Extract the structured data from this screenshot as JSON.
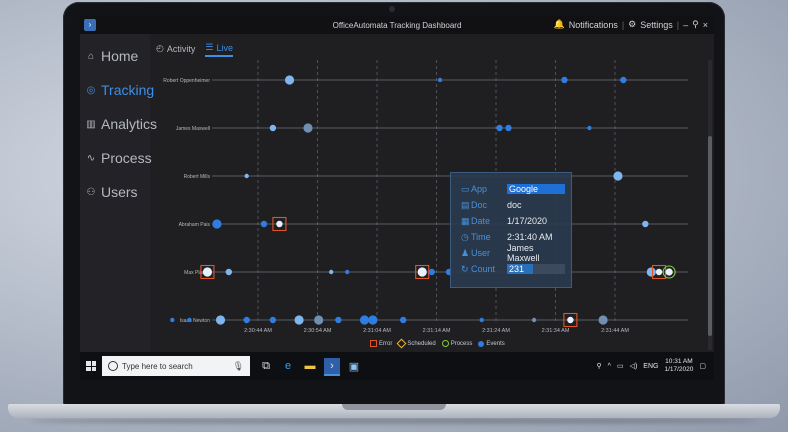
{
  "window": {
    "title": "OfficeAutomata Tracking Dashboard",
    "notifications_label": "Notifications",
    "settings_label": "Settings",
    "minimize_symbol": "–",
    "pin_symbol": "⚲",
    "close_symbol": "×",
    "logo_glyph": "›"
  },
  "sidebar": {
    "items": [
      {
        "label": "Home",
        "icon": "home-icon",
        "glyph": "⌂"
      },
      {
        "label": "Tracking",
        "icon": "radar-icon",
        "glyph": "◎",
        "active": true
      },
      {
        "label": "Analytics",
        "icon": "chart-icon",
        "glyph": "▥"
      },
      {
        "label": "Process",
        "icon": "process-icon",
        "glyph": "∿"
      },
      {
        "label": "Users",
        "icon": "users-icon",
        "glyph": "⚇"
      }
    ]
  },
  "tabs": [
    {
      "label": "Activity",
      "icon": "activity-icon",
      "glyph": "◴"
    },
    {
      "label": "Live",
      "icon": "live-icon",
      "glyph": "☰",
      "active": true
    }
  ],
  "tooltip": {
    "rows": [
      {
        "key": "App",
        "value": "Google",
        "icon": "window-icon",
        "glyph": "▭",
        "highlight": true
      },
      {
        "key": "Doc",
        "value": "doc",
        "icon": "document-icon",
        "glyph": "▤"
      },
      {
        "key": "Date",
        "value": "1/17/2020",
        "icon": "calendar-icon",
        "glyph": "▦"
      },
      {
        "key": "Time",
        "value": "2:31:40 AM",
        "icon": "clock-icon",
        "glyph": "◷"
      },
      {
        "key": "User",
        "value": "James Maxwell",
        "icon": "user-icon",
        "glyph": "♟"
      }
    ],
    "count": {
      "key": "Count",
      "value": "231",
      "icon": "count-icon",
      "glyph": "↻",
      "fill_fraction": 0.45
    }
  },
  "legend": [
    {
      "label": "Error",
      "shape": "square",
      "color": "#e2542a"
    },
    {
      "label": "Scheduled",
      "shape": "diamond",
      "color": "#f0b43c"
    },
    {
      "label": "Process",
      "shape": "circle",
      "color": "#7ccf3a"
    },
    {
      "label": "Events",
      "shape": "dot",
      "color": "#2f7de1"
    }
  ],
  "chart_data": {
    "type": "scatter",
    "categories": [
      "Robert Oppenheimer",
      "James Maxwell",
      "Robert Mills",
      "Abraham Pais",
      "Max Planck",
      "Isaac Newton"
    ],
    "x_ticks": [
      "2:30:44 AM",
      "2:30:54 AM",
      "2:31:04 AM",
      "2:31:14 AM",
      "2:31:24 AM",
      "2:31:34 AM",
      "2:31:44 AM"
    ],
    "x_unit": "seconds after 2:30:34 AM",
    "xlim": [
      0,
      80
    ],
    "grid": "vertical dashed",
    "legend_position": "bottom-center",
    "colors": {
      "event": "#2f7de1",
      "event_light": "#7fb6ee",
      "error": "#e2542a",
      "process": "#7ccf3a",
      "line": "#6e7077"
    },
    "points": [
      {
        "row": 0,
        "x": 15.3,
        "size": "large",
        "kind": "event_light"
      },
      {
        "row": 0,
        "x": 40.6,
        "size": "small",
        "kind": "event"
      },
      {
        "row": 0,
        "x": 61.5,
        "size": "medium",
        "kind": "event"
      },
      {
        "row": 0,
        "x": 71.4,
        "size": "medium",
        "kind": "event"
      },
      {
        "row": 1,
        "x": 12.5,
        "size": "medium",
        "kind": "event_light"
      },
      {
        "row": 1,
        "x": 18.4,
        "size": "large",
        "kind": "event_grey"
      },
      {
        "row": 1,
        "x": 50.6,
        "size": "medium",
        "kind": "event"
      },
      {
        "row": 1,
        "x": 52.1,
        "size": "medium",
        "kind": "event"
      },
      {
        "row": 1,
        "x": 65.7,
        "size": "small",
        "kind": "event"
      },
      {
        "row": 2,
        "x": 8.1,
        "size": "small",
        "kind": "event_light"
      },
      {
        "row": 2,
        "x": 70.5,
        "size": "large",
        "kind": "event_light"
      },
      {
        "row": 3,
        "x": 3.1,
        "size": "large",
        "kind": "event"
      },
      {
        "row": 3,
        "x": 11.0,
        "size": "medium",
        "kind": "event"
      },
      {
        "row": 3,
        "x": 13.6,
        "size": "medium",
        "kind": "error_box"
      },
      {
        "row": 3,
        "x": 75.1,
        "size": "medium",
        "kind": "event_light"
      },
      {
        "row": 4,
        "x": 1.5,
        "size": "large",
        "kind": "error_box"
      },
      {
        "row": 4,
        "x": 5.1,
        "size": "medium",
        "kind": "event_light"
      },
      {
        "row": 4,
        "x": 22.3,
        "size": "small",
        "kind": "event_light"
      },
      {
        "row": 4,
        "x": 25.0,
        "size": "small",
        "kind": "event"
      },
      {
        "row": 4,
        "x": 37.6,
        "size": "large",
        "kind": "error_box"
      },
      {
        "row": 4,
        "x": 39.2,
        "size": "medium",
        "kind": "event"
      },
      {
        "row": 4,
        "x": 42.1,
        "size": "medium",
        "kind": "event"
      },
      {
        "row": 4,
        "x": 56.6,
        "size": "small",
        "kind": "event_light"
      },
      {
        "row": 4,
        "x": 76.1,
        "size": "large",
        "kind": "event_light"
      },
      {
        "row": 4,
        "x": 77.4,
        "size": "medium",
        "kind": "error_box"
      },
      {
        "row": 4,
        "x": 79.1,
        "size": "large",
        "kind": "process"
      },
      {
        "row": 5,
        "x": -4.4,
        "size": "small",
        "kind": "event"
      },
      {
        "row": 5,
        "x": -1.5,
        "size": "small",
        "kind": "event"
      },
      {
        "row": 5,
        "x": 3.7,
        "size": "large",
        "kind": "event_light"
      },
      {
        "row": 5,
        "x": 8.1,
        "size": "medium",
        "kind": "event"
      },
      {
        "row": 5,
        "x": 12.5,
        "size": "medium",
        "kind": "event"
      },
      {
        "row": 5,
        "x": 16.9,
        "size": "large",
        "kind": "event_light"
      },
      {
        "row": 5,
        "x": 20.2,
        "size": "large",
        "kind": "event_grey"
      },
      {
        "row": 5,
        "x": 23.5,
        "size": "medium",
        "kind": "event"
      },
      {
        "row": 5,
        "x": 27.9,
        "size": "large",
        "kind": "event"
      },
      {
        "row": 5,
        "x": 29.3,
        "size": "large",
        "kind": "event"
      },
      {
        "row": 5,
        "x": 34.4,
        "size": "medium",
        "kind": "event"
      },
      {
        "row": 5,
        "x": 47.6,
        "size": "small",
        "kind": "event"
      },
      {
        "row": 5,
        "x": 56.4,
        "size": "small",
        "kind": "event_grey"
      },
      {
        "row": 5,
        "x": 62.5,
        "size": "medium",
        "kind": "error_box"
      },
      {
        "row": 5,
        "x": 68.0,
        "size": "large",
        "kind": "event_grey"
      }
    ]
  },
  "taskbar": {
    "search_placeholder": "Type here to search",
    "language": "ENG",
    "time": "10:31 AM",
    "date": "1/17/2020"
  }
}
